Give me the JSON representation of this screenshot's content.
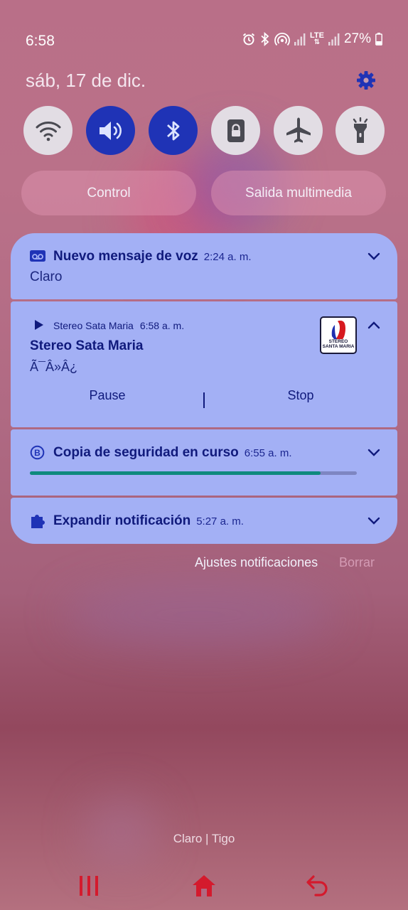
{
  "status_bar": {
    "time": "6:58",
    "network_type": "LTE",
    "battery": "27%",
    "icons": [
      "alarm-icon",
      "bluetooth-icon",
      "hotspot-icon",
      "signal-icon",
      "lte-icon",
      "signal-icon",
      "battery-icon"
    ]
  },
  "header": {
    "date": "sáb, 17 de dic.",
    "settings_icon": "gear-icon"
  },
  "quick_settings": {
    "tiles": [
      {
        "name": "wifi",
        "icon": "wifi-icon",
        "active": false
      },
      {
        "name": "sound",
        "icon": "volume-icon",
        "active": true
      },
      {
        "name": "bluetooth",
        "icon": "bluetooth-icon",
        "active": true
      },
      {
        "name": "lock",
        "icon": "lock-icon",
        "active": false
      },
      {
        "name": "airplane",
        "icon": "airplane-icon",
        "active": false
      },
      {
        "name": "flashlight",
        "icon": "flashlight-icon",
        "active": false
      }
    ],
    "device_control_label": "Control",
    "media_output_label": "Salida multimedia"
  },
  "notifications": {
    "voicemail": {
      "icon": "voicemail-icon",
      "title": "Nuevo mensaje de voz",
      "time": "2:24 a. m.",
      "body": "Claro"
    },
    "media": {
      "icon": "play-icon",
      "app": "Stereo Sata Maria",
      "time": "6:58 a. m.",
      "title": "Stereo Sata Maria",
      "subtitle": "Ã¯Â»Â¿",
      "artwork_text": [
        "STEREO",
        "SANTA MARIA"
      ],
      "pause_label": "Pause",
      "stop_label": "Stop"
    },
    "backup": {
      "icon": "backup-icon",
      "title": "Copia de seguridad en curso",
      "time": "6:55 a. m.",
      "progress": 0.89
    },
    "expand": {
      "icon": "puzzle-icon",
      "title": "Expandir notificación",
      "time": "5:27 a. m."
    }
  },
  "footer": {
    "settings_link": "Ajustes notificaciones",
    "clear_link": "Borrar"
  },
  "carrier": "Claro | Tigo",
  "navigation": {
    "recents_icon": "recents-icon",
    "home_icon": "home-icon",
    "back_icon": "back-icon"
  },
  "colors": {
    "accent": "#1f33b6",
    "card_background": "#a3b0f5",
    "card_text": "#101a7c",
    "progress": "#0f8a7d",
    "nav_icons": "#d41a2d"
  }
}
